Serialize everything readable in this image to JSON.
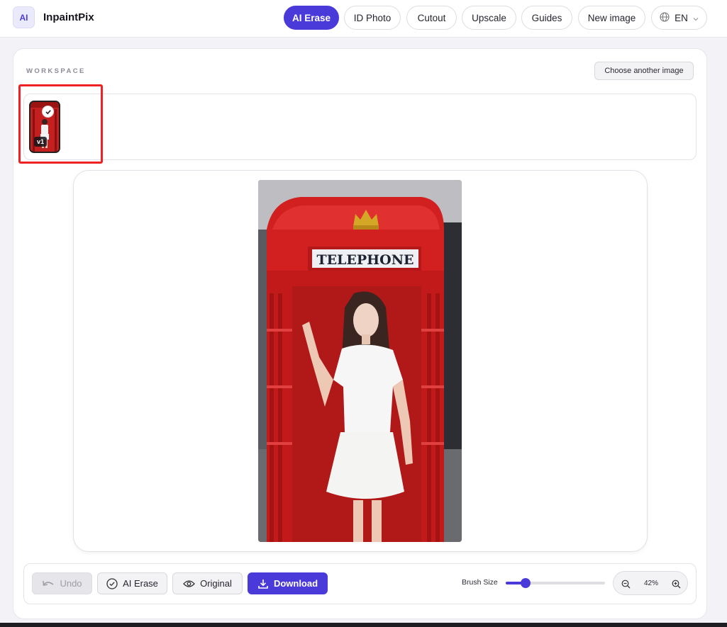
{
  "app": {
    "logo_text": "AI",
    "name": "InpaintPix"
  },
  "nav": {
    "items": [
      {
        "label": "AI Erase",
        "active": true
      },
      {
        "label": "ID Photo",
        "active": false
      },
      {
        "label": "Cutout",
        "active": false
      },
      {
        "label": "Upscale",
        "active": false
      },
      {
        "label": "Guides",
        "active": false
      },
      {
        "label": "New image",
        "active": false
      }
    ],
    "language": "EN"
  },
  "workspace": {
    "label": "WORKSPACE",
    "choose_button": "Choose another image",
    "thumbnail": {
      "version": "v1",
      "selected": true
    }
  },
  "photo": {
    "sign_text": "TELEPHONE"
  },
  "toolbar": {
    "undo": "Undo",
    "ai_erase": "AI Erase",
    "original": "Original",
    "download": "Download",
    "brush_label": "Brush Size",
    "brush_level": 0.2,
    "zoom": "42%"
  },
  "colors": {
    "accent": "#4a3ad9",
    "highlight": "#ee2222"
  }
}
